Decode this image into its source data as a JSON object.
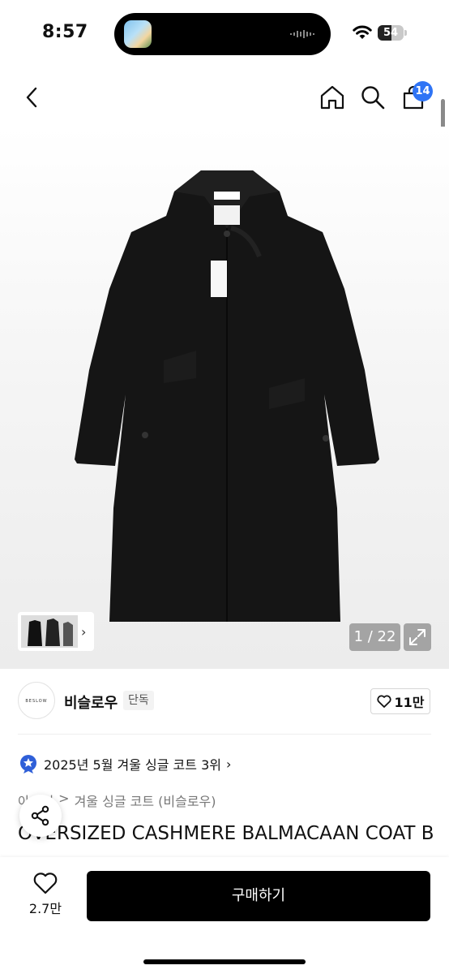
{
  "status_bar": {
    "time": "8:57",
    "battery": "54",
    "battery_level": 0.54
  },
  "nav": {
    "cart_count": "14"
  },
  "gallery": {
    "page_counter": "1 / 22"
  },
  "brand": {
    "logo_text": "BESLOW",
    "name": "비슬로우",
    "tag": "단독",
    "likes": "11만"
  },
  "ranking": {
    "text": "2025년 5월 겨울 싱글 코트 3위"
  },
  "breadcrumb": {
    "parent": "아우터",
    "separator": ">",
    "category": "겨울 싱글 코트 (비슬로우)"
  },
  "product": {
    "title": "OVERSIZED CASHMERE BALMACAAN COAT BLACK"
  },
  "bottom_bar": {
    "wish_count": "2.7만",
    "buy_label": "구매하기"
  },
  "colors": {
    "accent": "#2f74f5",
    "buy_button": "#000000"
  }
}
